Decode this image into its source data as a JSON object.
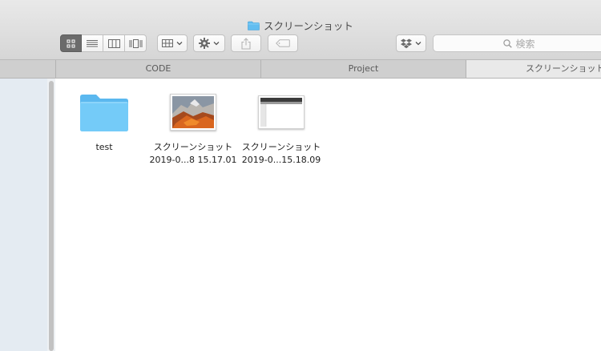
{
  "window": {
    "title": "スクリーンショット"
  },
  "toolbar": {
    "view_modes": [
      {
        "name": "icon-view",
        "icon": "grid-icon",
        "active": true
      },
      {
        "name": "list-view",
        "icon": "list-icon",
        "active": false
      },
      {
        "name": "column-view",
        "icon": "columns-icon",
        "active": false
      },
      {
        "name": "gallery-view",
        "icon": "gallery-icon",
        "active": false
      }
    ],
    "search": {
      "placeholder": "検索"
    }
  },
  "tabs": [
    {
      "label": "CODE",
      "active": false
    },
    {
      "label": "Project",
      "active": false
    },
    {
      "label": "スクリーンショット",
      "active": true
    }
  ],
  "files": [
    {
      "name": "test",
      "name_line2": "",
      "kind": "folder"
    },
    {
      "name": "スクリーンショット",
      "name_line2": "2019-0...8 15.17.01",
      "kind": "image-mountain"
    },
    {
      "name": "スクリーンショット",
      "name_line2": "2019-0...15.18.09",
      "kind": "image-window"
    }
  ],
  "colors": {
    "folder": "#67c5f6",
    "active_view": "#6b6b6b",
    "sidebar": "#e4ebf2"
  }
}
